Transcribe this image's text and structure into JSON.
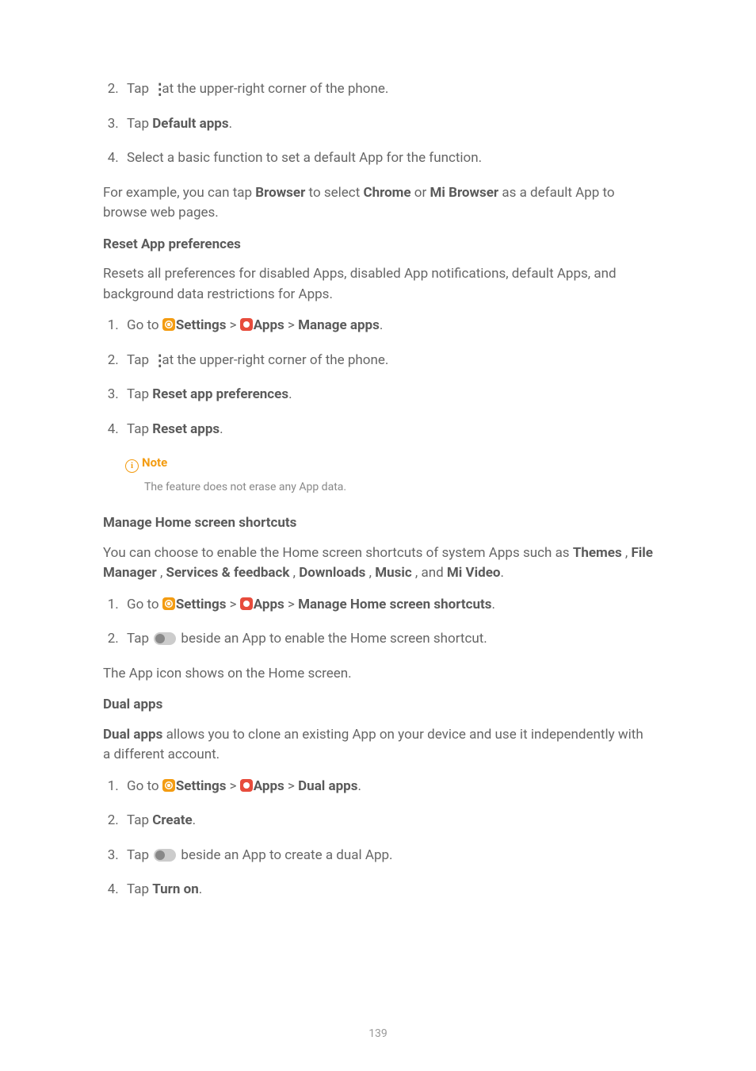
{
  "section1": {
    "step2_a": "Tap ",
    "step2_b": " at the upper-right corner of the phone.",
    "step3_a": "Tap ",
    "step3_b": "Default apps",
    "step3_c": ".",
    "step4": "Select a basic function to set a default App for the function.",
    "example_a": "For example, you can tap ",
    "example_b": "Browser",
    "example_c": " to select ",
    "example_d": "Chrome",
    "example_e": " or ",
    "example_f": "Mi Browser",
    "example_g": " as a default App to browse web pages."
  },
  "section2": {
    "heading": "Reset App preferences",
    "intro": "Resets all preferences for disabled Apps, disabled App notifications, default Apps, and background data restrictions for Apps.",
    "s1_a": "Go to ",
    "s1_settings": "Settings",
    "s1_apps": "Apps",
    "s1_manage": "Manage apps",
    "s1_dot": ".",
    "s2_a": "Tap ",
    "s2_b": " at the upper-right corner of the phone.",
    "s3_a": "Tap ",
    "s3_b": "Reset app preferences",
    "s3_c": ".",
    "s4_a": "Tap ",
    "s4_b": "Reset apps",
    "s4_c": ".",
    "note_label": "Note",
    "note_body": "The feature does not erase any App data."
  },
  "section3": {
    "heading": "Manage Home screen shortcuts",
    "intro_a": "You can choose to enable the Home screen shortcuts of system Apps such as ",
    "t1": "Themes",
    "t2": "File Manager",
    "t3": "Services & feedback",
    "t4": "Downloads",
    "t5": "Music",
    "and": " , and ",
    "t6": "Mi Video",
    "intro_c": ".",
    "s1_a": "Go to ",
    "s1_settings": "Settings",
    "s1_apps": "Apps",
    "s1_target": "Manage Home screen shortcuts",
    "s1_dot": ".",
    "s2_a": "Tap ",
    "s2_b": " beside an App to enable the Home screen shortcut.",
    "outro": "The App icon shows on the Home screen."
  },
  "section4": {
    "heading": "Dual apps",
    "intro_a": "Dual apps",
    "intro_b": " allows you to clone an existing App on your device and use it independently with a different account.",
    "s1_a": "Go to ",
    "s1_settings": "Settings",
    "s1_apps": "Apps",
    "s1_target": "Dual apps",
    "s1_dot": ".",
    "s2_a": "Tap ",
    "s2_b": "Create",
    "s2_c": ".",
    "s3_a": "Tap ",
    "s3_b": " beside an App to create a dual App.",
    "s4_a": "Tap ",
    "s4_b": "Turn on",
    "s4_c": "."
  },
  "page_number": "139",
  "sep": " > "
}
